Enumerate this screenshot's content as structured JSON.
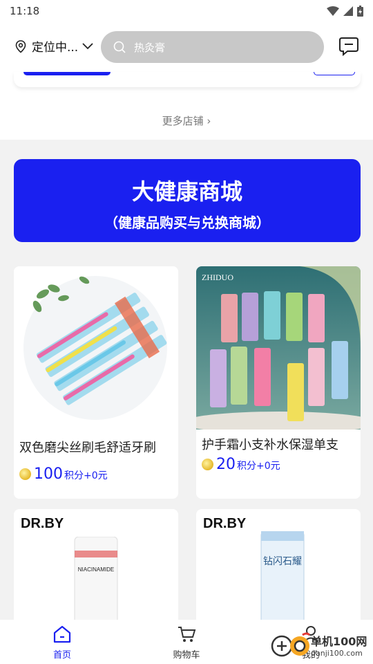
{
  "status_bar": {
    "time": "11:18"
  },
  "header": {
    "location_label": "定位中...",
    "search_placeholder": "热灸膏"
  },
  "shops": {
    "more_label": "更多店铺 ›"
  },
  "banner": {
    "title": "大健康商城",
    "subtitle": "（健康品购买与兑换商城）"
  },
  "products": [
    {
      "title": "双色磨尖丝刷毛舒适牙刷",
      "points": "100",
      "unit": "积分+0元"
    },
    {
      "title": "护手霜小支补水保湿单支",
      "points": "20",
      "unit": "积分+0元",
      "brand_text": "ZHIDUO"
    },
    {
      "brand": "DR.BY",
      "tube_text": "NIACINAMIDE"
    },
    {
      "brand": "DR.BY",
      "tube_text": "钻闪石耀"
    }
  ],
  "bottom_nav": [
    {
      "label": "首页",
      "active": true
    },
    {
      "label": "购物车",
      "active": false
    },
    {
      "label": "我的",
      "active": false
    }
  ],
  "watermark": {
    "line1": "单机100网",
    "line2": "danji100.com"
  },
  "colors": {
    "accent": "#1a20f0",
    "search_bg": "#c8c8c8"
  }
}
